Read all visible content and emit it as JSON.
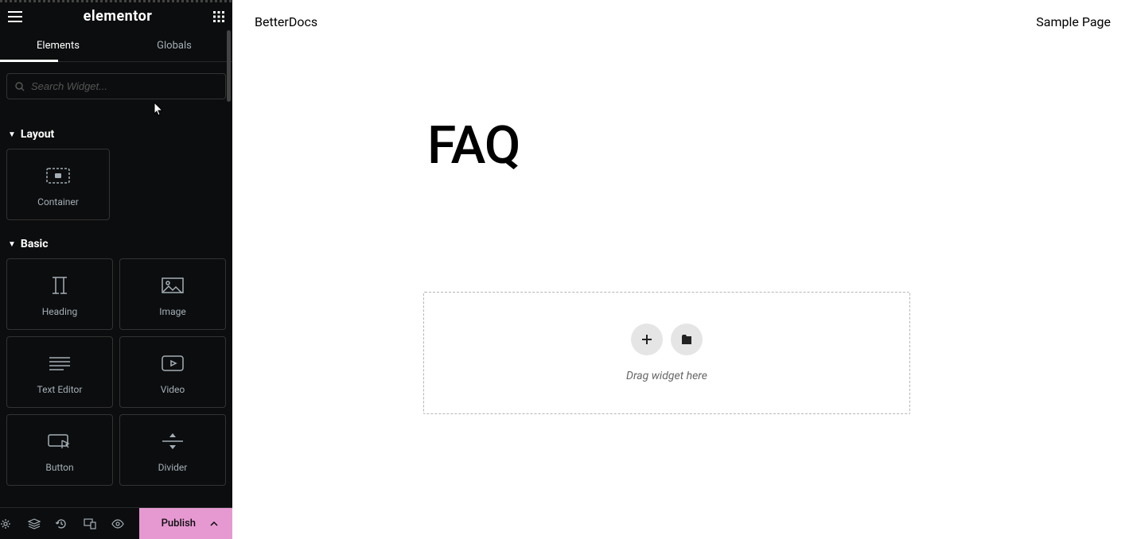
{
  "header": {
    "logo": "elementor"
  },
  "tabs": {
    "elements": "Elements",
    "globals": "Globals"
  },
  "search": {
    "placeholder": "Search Widget..."
  },
  "categories": {
    "layout": {
      "title": "Layout",
      "widgets": [
        {
          "label": "Container"
        }
      ]
    },
    "basic": {
      "title": "Basic",
      "widgets": [
        {
          "label": "Heading"
        },
        {
          "label": "Image"
        },
        {
          "label": "Text Editor"
        },
        {
          "label": "Video"
        },
        {
          "label": "Button"
        },
        {
          "label": "Divider"
        }
      ]
    }
  },
  "footer": {
    "publish": "Publish"
  },
  "canvas": {
    "nav_left": "BetterDocs",
    "nav_right": "Sample Page",
    "title": "FAQ",
    "drop_hint": "Drag widget here"
  }
}
